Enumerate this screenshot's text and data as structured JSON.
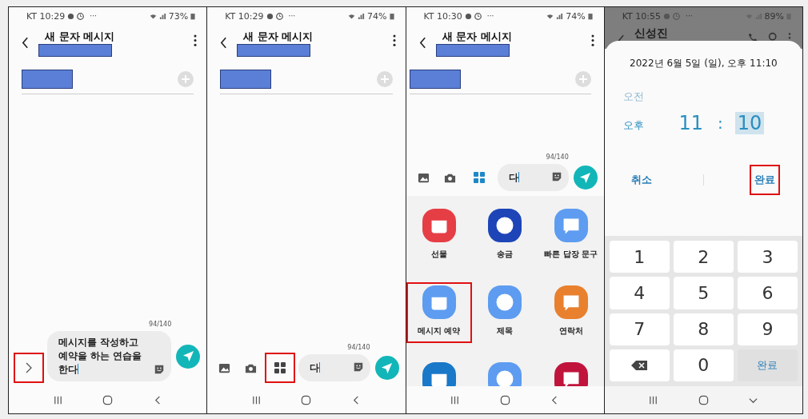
{
  "panels": [
    {
      "kind": "compose",
      "status": {
        "time": "KT 10:29",
        "more": "···",
        "battery": "73%"
      },
      "title": "새 문자 메시지",
      "counter": "94/140",
      "expand_highlighted": true,
      "message": "메시지를 작성하고 예약을 하는 연습을 한다"
    },
    {
      "kind": "compose",
      "status": {
        "time": "KT 10:29",
        "more": "···",
        "battery": "74%"
      },
      "title": "새 문자 메시지",
      "counter": "94/140",
      "toolbar": {
        "apps_selected": false,
        "apps_highlighted": true
      },
      "input": "다"
    },
    {
      "kind": "compose",
      "status": {
        "time": "KT 10:30",
        "more": "···",
        "battery": "74%"
      },
      "title": "새 문자 메시지",
      "counter": "94/140",
      "toolbar": {
        "apps_selected": true,
        "apps_highlighted": false
      },
      "input": "다",
      "menu": [
        {
          "label": "선물",
          "color": "#e63e45",
          "highlighted": false
        },
        {
          "label": "송금",
          "color": "#1d45b8",
          "highlighted": false
        },
        {
          "label": "빠른 답장 문구",
          "color": "#5d9cf0",
          "highlighted": false
        },
        {
          "label": "메시지 예약",
          "color": "#5d9cf0",
          "highlighted": true
        },
        {
          "label": "제목",
          "color": "#5d9cf0",
          "highlighted": false
        },
        {
          "label": "연락처",
          "color": "#e8802e",
          "highlighted": false
        },
        {
          "color": "#1a78c8",
          "highlighted": false
        },
        {
          "color": "#5d9cf0",
          "highlighted": false
        },
        {
          "color": "#c0143c",
          "highlighted": false
        }
      ]
    },
    {
      "kind": "schedule",
      "status": {
        "time": "KT 10:55",
        "more": "···",
        "battery": "89%"
      },
      "contact": "신성진",
      "dialog": {
        "date": "2022년 6월 5일 (일), 오후 11:10",
        "periods": [
          {
            "label": "오전",
            "selected": false
          },
          {
            "label": "오후",
            "selected": true
          }
        ],
        "hour": "11",
        "separator": ":",
        "minute": "10",
        "minute_selected": true,
        "buttons": [
          {
            "label": "취소",
            "highlighted": false
          },
          {
            "label": "완료",
            "highlighted": true
          }
        ]
      },
      "keypad": [
        {
          "kind": "key",
          "label": "1"
        },
        {
          "kind": "key",
          "label": "2"
        },
        {
          "kind": "key",
          "label": "3"
        },
        {
          "kind": "key",
          "label": "4"
        },
        {
          "kind": "key",
          "label": "5"
        },
        {
          "kind": "key",
          "label": "6"
        },
        {
          "kind": "key",
          "label": "7"
        },
        {
          "kind": "key",
          "label": "8"
        },
        {
          "kind": "key",
          "label": "9"
        },
        {
          "kind": "backspace"
        },
        {
          "kind": "key",
          "label": "0"
        },
        {
          "kind": "done",
          "label": "완료"
        }
      ]
    }
  ]
}
